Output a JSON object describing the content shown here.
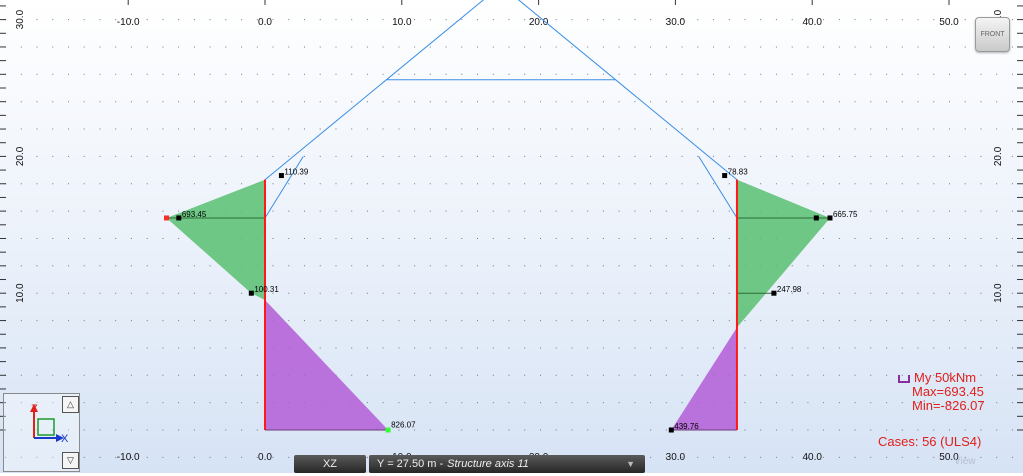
{
  "view": {
    "front_button": "FRONT",
    "x_ticks": [
      {
        "value": -10,
        "label": "-10.0"
      },
      {
        "value": 0,
        "label": "0.0"
      },
      {
        "value": 10,
        "label": "10.0"
      },
      {
        "value": 20,
        "label": "20.0"
      },
      {
        "value": 30,
        "label": "30.0"
      },
      {
        "value": 40,
        "label": "40.0"
      },
      {
        "value": 50,
        "label": "50.0"
      }
    ],
    "y_ticks": [
      {
        "value": 10,
        "label": "10.0"
      },
      {
        "value": 20,
        "label": "20.0"
      },
      {
        "value": 30,
        "label": "30.0"
      }
    ],
    "colors": {
      "positive_fill": "#58c070",
      "negative_fill": "#b35cd6",
      "member": "#ff1a1a",
      "truss": "#3a8ee6",
      "legend_text": "#e0201b"
    }
  },
  "structure": {
    "columns": [
      {
        "x": 0,
        "y_bottom": 0,
        "y_top": 18.3
      },
      {
        "x": 34.5,
        "y_bottom": 0,
        "y_top": 18.3
      }
    ],
    "truss_lines": [
      [
        [
          0,
          18.3
        ],
        [
          17.25,
          32.5
        ]
      ],
      [
        [
          17.25,
          32.5
        ],
        [
          34.5,
          18.3
        ]
      ],
      [
        [
          8.9,
          25.6
        ],
        [
          25.6,
          25.6
        ]
      ],
      [
        [
          0,
          15.5
        ],
        [
          2.8,
          20.0
        ]
      ],
      [
        [
          34.5,
          15.5
        ],
        [
          31.7,
          20.0
        ]
      ]
    ]
  },
  "moment_diagram": {
    "positive_regions": [
      [
        [
          0,
          18.3
        ],
        [
          -7.2,
          15.5
        ],
        [
          -1.0,
          10.0
        ],
        [
          0,
          9.5
        ]
      ],
      [
        [
          34.5,
          18.3
        ],
        [
          41.3,
          15.5
        ],
        [
          34.5,
          7.5
        ]
      ]
    ],
    "negative_regions": [
      [
        [
          0,
          9.5
        ],
        [
          9.0,
          0
        ],
        [
          0,
          0
        ]
      ],
      [
        [
          34.5,
          7.5
        ],
        [
          34.5,
          0
        ],
        [
          29.7,
          0
        ]
      ]
    ],
    "inner_lines": [
      [
        [
          -7.2,
          15.5
        ],
        [
          0,
          15.5
        ]
      ],
      [
        [
          34.5,
          15.5
        ],
        [
          41.3,
          15.5
        ]
      ],
      [
        [
          34.5,
          10.0
        ],
        [
          37.2,
          10.0
        ]
      ]
    ],
    "value_labels": [
      {
        "text": "110.39",
        "x": 1.2,
        "y": 18.6
      },
      {
        "text": "693.45",
        "x": -6.3,
        "y": 15.5
      },
      {
        "text": "100.31",
        "x": -1.0,
        "y": 10.0
      },
      {
        "text": "826.07",
        "x": 9.0,
        "y": 0.1
      },
      {
        "text": "78.83",
        "x": 33.6,
        "y": 18.6
      },
      {
        "text": "665.75",
        "x": 41.3,
        "y": 15.5
      },
      {
        "text": "247.98",
        "x": 37.2,
        "y": 10.0
      },
      {
        "text": "439.76",
        "x": 29.7,
        "y": 0
      }
    ],
    "special_markers": [
      {
        "x": -7.2,
        "y": 15.5,
        "color": "#ff2a2a"
      },
      {
        "x": 9.0,
        "y": 0,
        "color": "#33ff33"
      }
    ],
    "black_markers": [
      {
        "x": -6.3,
        "y": 15.5
      },
      {
        "x": 1.2,
        "y": 18.6
      },
      {
        "x": -1.0,
        "y": 10.0
      },
      {
        "x": 33.6,
        "y": 18.6
      },
      {
        "x": 40.3,
        "y": 15.5
      },
      {
        "x": 41.3,
        "y": 15.5
      },
      {
        "x": 37.2,
        "y": 10.0
      },
      {
        "x": 29.7,
        "y": 0
      }
    ]
  },
  "legend": {
    "quantity": "My  50kNm",
    "max": "Max=693.45",
    "min": "Min=-826.07"
  },
  "cases": "Cases: 56 (ULS4)",
  "axis_widget": {
    "z_label": "Z",
    "x_label": "X",
    "up_icon": "triangle-up",
    "down_icon": "triangle-down"
  },
  "status_bar": {
    "plane": "XZ",
    "axis_prefix": "Y = 27.50 m - ",
    "axis_name": "Structure axis 11",
    "dropdown_icon": "chevron-down"
  },
  "view_tag": "View"
}
